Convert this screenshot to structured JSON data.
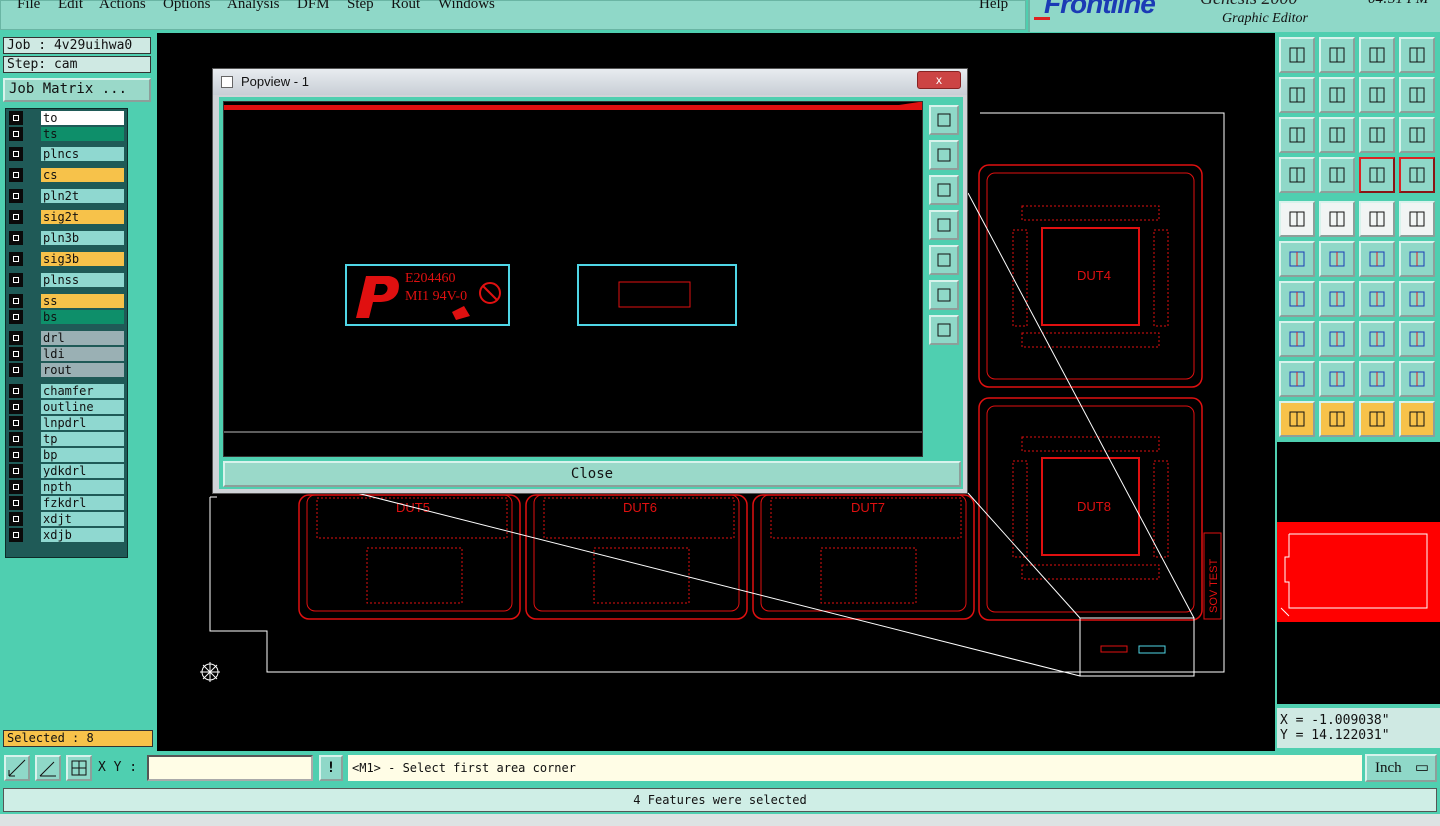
{
  "menu": [
    "File",
    "Edit",
    "Actions",
    "Options",
    "Analysis",
    "DFM",
    "Step",
    "Rout",
    "Windows"
  ],
  "help": "Help",
  "brand": {
    "logo": "Frontline",
    "product": "Genesis 2000",
    "subtitle": "Graphic Editor",
    "time": "04:31 PM"
  },
  "job": {
    "job_label": "Job : 4v29uihwa0",
    "step_label": "Step: cam",
    "matrix_button": "Job Matrix ..."
  },
  "layers": [
    {
      "name": "to",
      "color": "#ffffff"
    },
    {
      "name": "ts",
      "color": "#0e8f6a"
    },
    {
      "name": "plncs",
      "color": "#8fd8d0"
    },
    {
      "name": "cs",
      "color": "#f7c24a"
    },
    {
      "name": "pln2t",
      "color": "#8fd8d0"
    },
    {
      "name": "sig2t",
      "color": "#f7c24a"
    },
    {
      "name": "pln3b",
      "color": "#8fd8d0"
    },
    {
      "name": "sig3b",
      "color": "#f7c24a"
    },
    {
      "name": "plnss",
      "color": "#8fd8d0"
    },
    {
      "name": "ss",
      "color": "#f7c24a"
    },
    {
      "name": "bs",
      "color": "#0e8f6a"
    },
    {
      "name": "drl",
      "color": "#9ab0b4"
    },
    {
      "name": "ldi",
      "color": "#9ab0b4"
    },
    {
      "name": "rout",
      "color": "#9ab0b4"
    },
    {
      "name": "chamfer",
      "color": "#8fd8d0"
    },
    {
      "name": "outline",
      "color": "#8fd8d0"
    },
    {
      "name": "lnpdrl",
      "color": "#8fd8d0"
    },
    {
      "name": "tp",
      "color": "#8fd8d0"
    },
    {
      "name": "bp",
      "color": "#8fd8d0"
    },
    {
      "name": "ydkdrl",
      "color": "#8fd8d0"
    },
    {
      "name": "npth",
      "color": "#8fd8d0"
    },
    {
      "name": "fzkdrl",
      "color": "#8fd8d0"
    },
    {
      "name": "xdjt",
      "color": "#8fd8d0"
    },
    {
      "name": "xdjb",
      "color": "#8fd8d0"
    }
  ],
  "selected": "Selected : 8",
  "canvas": {
    "dut_labels": [
      "DUT4",
      "DUT5",
      "DUT6",
      "DUT7",
      "DUT8"
    ],
    "side_text": "SOV TEST"
  },
  "popup": {
    "title": "Popview - 1",
    "close_x": "x",
    "marking_line1": "E204460",
    "marking_line2": "MI1 94V-0",
    "close_button": "Close"
  },
  "coords": {
    "x": "X = -1.009038\"",
    "y": "Y = 14.122031\""
  },
  "input": {
    "xy_label": "X Y :",
    "xy_value": "",
    "prompt": "<M1> - Select first area corner",
    "unit": "Inch"
  },
  "status": "4 Features were selected"
}
